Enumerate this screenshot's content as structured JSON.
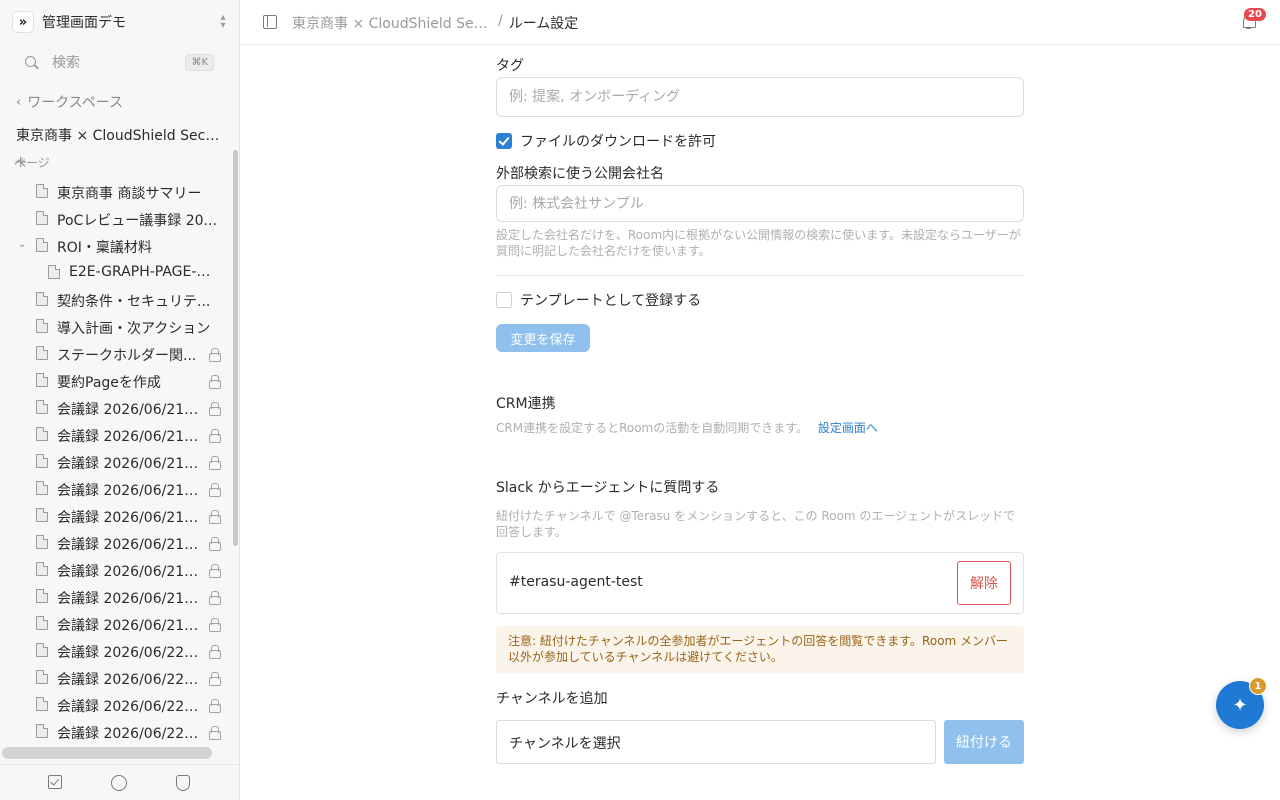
{
  "workspace": {
    "name": "管理画面デモ",
    "logo_glyph": "»"
  },
  "search": {
    "placeholder": "検索",
    "shortcut": "⌘K"
  },
  "nav": {
    "back_label": "ワークスペース"
  },
  "room": {
    "name": "東京商事 × CloudShield Securi..."
  },
  "pages": {
    "header": "ページ",
    "items": [
      {
        "label": "東京商事 商談サマリー",
        "level": 0,
        "locked": false,
        "expanded": false
      },
      {
        "label": "PoCレビュー議事録 20...",
        "level": 0,
        "locked": false,
        "expanded": false
      },
      {
        "label": "ROI・稟議材料",
        "level": 0,
        "locked": false,
        "expanded": true
      },
      {
        "label": "E2E-GRAPH-PAGE-2...",
        "level": 1,
        "locked": false,
        "expanded": false
      },
      {
        "label": "契約条件・セキュリテ...",
        "level": 0,
        "locked": false,
        "expanded": false
      },
      {
        "label": "導入計画・次アクション",
        "level": 0,
        "locked": false,
        "expanded": false
      },
      {
        "label": "ステークホルダー関...",
        "level": 0,
        "locked": true,
        "expanded": false
      },
      {
        "label": "要約Pageを作成",
        "level": 0,
        "locked": true,
        "expanded": false
      },
      {
        "label": "会議録 2026/06/21 0...",
        "level": 0,
        "locked": true,
        "expanded": false
      },
      {
        "label": "会議録 2026/06/21 0...",
        "level": 0,
        "locked": true,
        "expanded": false
      },
      {
        "label": "会議録 2026/06/21 1...",
        "level": 0,
        "locked": true,
        "expanded": false
      },
      {
        "label": "会議録 2026/06/21 1...",
        "level": 0,
        "locked": true,
        "expanded": false
      },
      {
        "label": "会議録 2026/06/21 1...",
        "level": 0,
        "locked": true,
        "expanded": false
      },
      {
        "label": "会議録 2026/06/21 1...",
        "level": 0,
        "locked": true,
        "expanded": false
      },
      {
        "label": "会議録 2026/06/21 1...",
        "level": 0,
        "locked": true,
        "expanded": false
      },
      {
        "label": "会議録 2026/06/21 1...",
        "level": 0,
        "locked": true,
        "expanded": false
      },
      {
        "label": "会議録 2026/06/21 1...",
        "level": 0,
        "locked": true,
        "expanded": false
      },
      {
        "label": "会議録 2026/06/22 0...",
        "level": 0,
        "locked": true,
        "expanded": false
      },
      {
        "label": "会議録 2026/06/22 0...",
        "level": 0,
        "locked": true,
        "expanded": false
      },
      {
        "label": "会議録 2026/06/22 0...",
        "level": 0,
        "locked": true,
        "expanded": false
      },
      {
        "label": "会議録 2026/06/22 1...",
        "level": 0,
        "locked": true,
        "expanded": false
      }
    ]
  },
  "topbar": {
    "breadcrumb_parent": "東京商事 × CloudShield Secu...",
    "breadcrumb_sep": "/",
    "breadcrumb_current": "ルーム設定",
    "notification_count": "20"
  },
  "form": {
    "tag_label": "タグ",
    "tag_placeholder": "例: 提案, オンボーディング",
    "allow_download_label": "ファイルのダウンロードを許可",
    "allow_download_checked": true,
    "company_label": "外部検索に使う公開会社名",
    "company_placeholder": "例: 株式会社サンプル",
    "company_help": "設定した会社名だけを、Room内に根拠がない公開情報の検索に使います。未設定ならユーザーが質問に明記した会社名だけを使います。",
    "template_label": "テンプレートとして登録する",
    "template_checked": false,
    "save_label": "変更を保存"
  },
  "crm": {
    "title": "CRM連携",
    "description": "CRM連携を設定するとRoomの活動を自動同期できます。",
    "link_label": "設定画面へ"
  },
  "slack": {
    "title": "Slack からエージェントに質問する",
    "description": "紐付けたチャンネルで @Terasu をメンションすると、この Room のエージェントがスレッドで回答します。",
    "channel": "#terasu-agent-test",
    "remove_label": "解除",
    "warning": "注意: 紐付けたチャンネルの全参加者がエージェントの回答を閲覧できます。Room メンバー以外が参加しているチャンネルは避けてください。",
    "add_label": "チャンネルを追加",
    "select_value": "チャンネルを選択",
    "link_button": "紐付ける"
  },
  "assistant": {
    "badge": "1",
    "icon": "sparkle-icon"
  },
  "colors": {
    "accent": "#2d7fd4",
    "danger": "#d9534f",
    "warning_bg": "#fbf4ea",
    "badge": "#e5484d"
  }
}
